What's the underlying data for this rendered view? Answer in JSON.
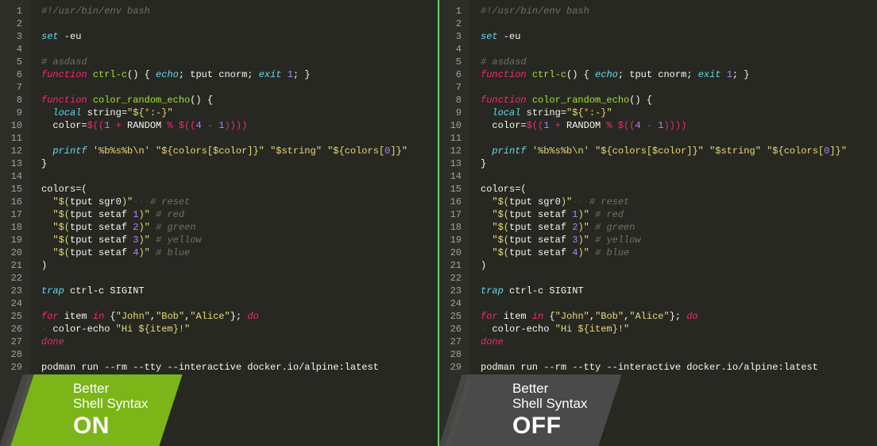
{
  "badge": {
    "title": "Better",
    "subtitle": "Shell Syntax",
    "on": "ON",
    "off": "OFF"
  },
  "code": [
    {
      "n": 1,
      "tokens": [
        [
          "c-comment",
          "#!/usr/bin/env bash"
        ]
      ]
    },
    {
      "n": 2,
      "tokens": []
    },
    {
      "n": 3,
      "tokens": [
        [
          "c-def",
          "set"
        ],
        [
          "c-plain",
          " -eu"
        ]
      ]
    },
    {
      "n": 4,
      "tokens": []
    },
    {
      "n": 5,
      "tokens": [
        [
          "c-comment",
          "# asdasd"
        ]
      ]
    },
    {
      "n": 6,
      "tokens": [
        [
          "c-kw",
          "function"
        ],
        [
          "c-plain",
          " "
        ],
        [
          "c-fn",
          "ctrl-c"
        ],
        [
          "c-plain",
          "() { "
        ],
        [
          "c-def",
          "echo"
        ],
        [
          "c-plain",
          "; "
        ],
        [
          "c-plain",
          "tput cnorm; "
        ],
        [
          "c-def",
          "exit"
        ],
        [
          "c-plain",
          " "
        ],
        [
          "c-num",
          "1"
        ],
        [
          "c-plain",
          "; }"
        ]
      ]
    },
    {
      "n": 7,
      "tokens": []
    },
    {
      "n": 8,
      "tokens": [
        [
          "c-kw",
          "function"
        ],
        [
          "c-plain",
          " "
        ],
        [
          "c-fn",
          "color_random_echo"
        ],
        [
          "c-plain",
          "() {"
        ]
      ]
    },
    {
      "n": 9,
      "tokens": [
        [
          "c-plain",
          "  "
        ],
        [
          "c-def",
          "local"
        ],
        [
          "c-plain",
          " string="
        ],
        [
          "c-str",
          "\"${"
        ],
        [
          "c-var",
          "*"
        ],
        [
          "c-str",
          ":-}\""
        ]
      ]
    },
    {
      "n": 10,
      "tokens": [
        [
          "c-plain",
          "  color="
        ],
        [
          "c-op",
          "$(("
        ],
        [
          "c-num",
          "1"
        ],
        [
          "c-plain",
          " "
        ],
        [
          "c-op",
          "+"
        ],
        [
          "c-plain",
          " RANDOM "
        ],
        [
          "c-op",
          "%"
        ],
        [
          "c-plain",
          " "
        ],
        [
          "c-op",
          "$(("
        ],
        [
          "c-num",
          "4"
        ],
        [
          "c-plain",
          " "
        ],
        [
          "c-op",
          "-"
        ],
        [
          "c-plain",
          " "
        ],
        [
          "c-num",
          "1"
        ],
        [
          "c-op",
          "))))"
        ]
      ]
    },
    {
      "n": 11,
      "tokens": []
    },
    {
      "n": 12,
      "tokens": [
        [
          "c-plain",
          "  "
        ],
        [
          "c-def",
          "printf"
        ],
        [
          "c-plain",
          " "
        ],
        [
          "c-str",
          "'%b%s%b\\n'"
        ],
        [
          "c-plain",
          " "
        ],
        [
          "c-str",
          "\"${colors[$color]}\""
        ],
        [
          "c-plain",
          " "
        ],
        [
          "c-str",
          "\"$string\""
        ],
        [
          "c-plain",
          " "
        ],
        [
          "c-str",
          "\"${colors["
        ],
        [
          "c-num",
          "0"
        ],
        [
          "c-str",
          "]}\""
        ]
      ]
    },
    {
      "n": 13,
      "tokens": [
        [
          "c-plain",
          "}"
        ]
      ]
    },
    {
      "n": 14,
      "tokens": []
    },
    {
      "n": 15,
      "tokens": [
        [
          "c-plain",
          "colors=("
        ]
      ]
    },
    {
      "n": 16,
      "tokens": [
        [
          "c-plain",
          "  "
        ],
        [
          "c-str",
          "\"$("
        ],
        [
          "c-plain",
          "tput sgr0"
        ],
        [
          "c-str",
          ")\""
        ],
        [
          "ws",
          "···"
        ],
        [
          "c-comment",
          "# reset"
        ]
      ]
    },
    {
      "n": 17,
      "tokens": [
        [
          "c-plain",
          "  "
        ],
        [
          "c-str",
          "\"$("
        ],
        [
          "c-plain",
          "tput setaf "
        ],
        [
          "c-num",
          "1"
        ],
        [
          "c-str",
          ")\""
        ],
        [
          "c-plain",
          " "
        ],
        [
          "c-comment",
          "# red"
        ]
      ]
    },
    {
      "n": 18,
      "tokens": [
        [
          "c-plain",
          "  "
        ],
        [
          "c-str",
          "\"$("
        ],
        [
          "c-plain",
          "tput setaf "
        ],
        [
          "c-num",
          "2"
        ],
        [
          "c-str",
          ")\""
        ],
        [
          "c-plain",
          " "
        ],
        [
          "c-comment",
          "# green"
        ]
      ]
    },
    {
      "n": 19,
      "tokens": [
        [
          "c-plain",
          "  "
        ],
        [
          "c-str",
          "\"$("
        ],
        [
          "c-plain",
          "tput setaf "
        ],
        [
          "c-num",
          "3"
        ],
        [
          "c-str",
          ")\""
        ],
        [
          "c-plain",
          " "
        ],
        [
          "c-comment",
          "# yellow"
        ]
      ]
    },
    {
      "n": 20,
      "tokens": [
        [
          "c-plain",
          "  "
        ],
        [
          "c-str",
          "\"$("
        ],
        [
          "c-plain",
          "tput setaf "
        ],
        [
          "c-num",
          "4"
        ],
        [
          "c-str",
          ")\""
        ],
        [
          "c-plain",
          " "
        ],
        [
          "c-comment",
          "# blue"
        ]
      ]
    },
    {
      "n": 21,
      "tokens": [
        [
          "c-plain",
          ")"
        ]
      ]
    },
    {
      "n": 22,
      "tokens": []
    },
    {
      "n": 23,
      "tokens": [
        [
          "c-def",
          "trap"
        ],
        [
          "c-plain",
          " ctrl-c SIGINT"
        ]
      ]
    },
    {
      "n": 24,
      "tokens": []
    },
    {
      "n": 25,
      "tokens": [
        [
          "c-kw",
          "for"
        ],
        [
          "c-plain",
          " item "
        ],
        [
          "c-kw",
          "in"
        ],
        [
          "c-plain",
          " {"
        ],
        [
          "c-str",
          "\"John\""
        ],
        [
          "c-plain",
          ","
        ],
        [
          "c-str",
          "\"Bob\""
        ],
        [
          "c-plain",
          ","
        ],
        [
          "c-str",
          "\"Alice\""
        ],
        [
          "c-plain",
          "}; "
        ],
        [
          "c-kw",
          "do"
        ]
      ]
    },
    {
      "n": 26,
      "tokens": [
        [
          "ws",
          "·"
        ],
        [
          "c-plain",
          " color-echo "
        ],
        [
          "c-str",
          "\"Hi ${item}!\""
        ]
      ]
    },
    {
      "n": 27,
      "tokens": [
        [
          "c-kw",
          "done"
        ]
      ]
    },
    {
      "n": 28,
      "tokens": []
    },
    {
      "n": 29,
      "tokens": [
        [
          "c-plain",
          "podman run --rm --tty --interactive docker.io/alpine:latest"
        ]
      ]
    }
  ]
}
